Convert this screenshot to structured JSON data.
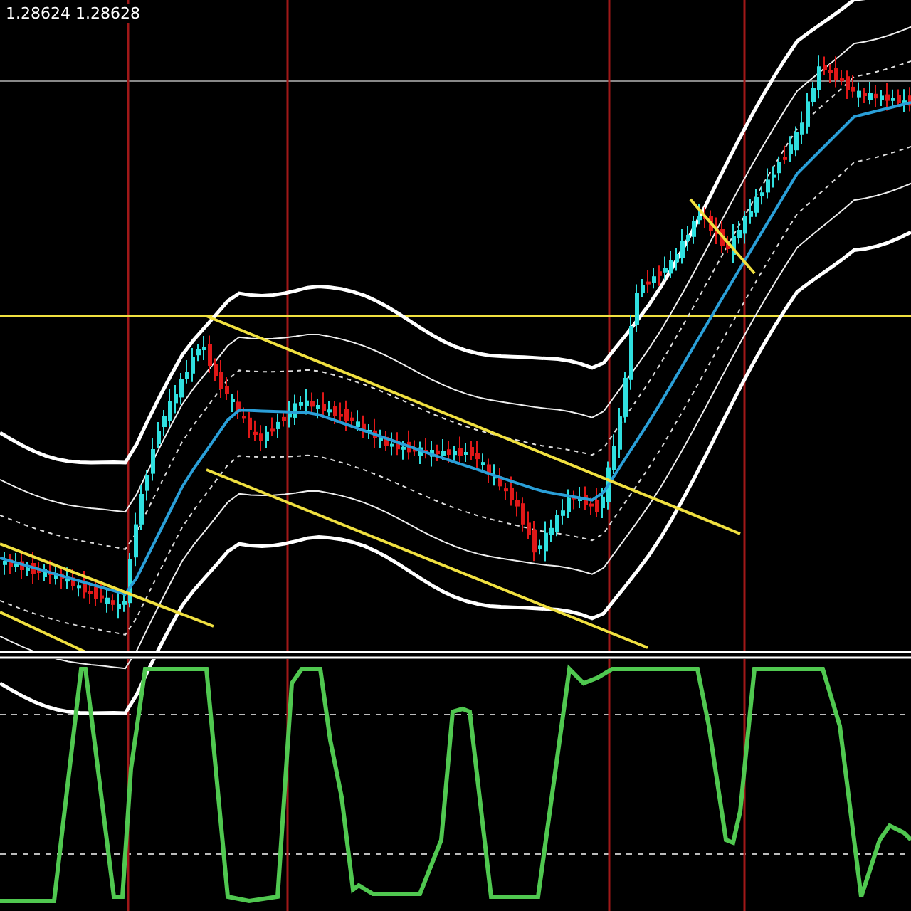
{
  "chart_header": {
    "quote": "1.28624 1.28628"
  }
}
